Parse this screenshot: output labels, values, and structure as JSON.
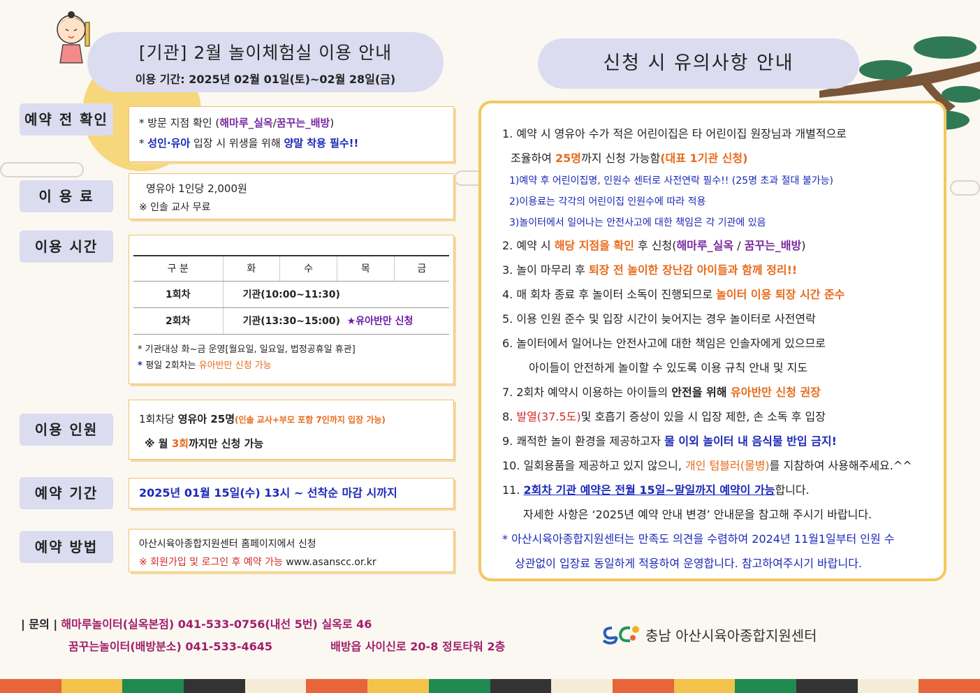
{
  "title": {
    "main": "[기관] 2월 놀이체험실 이용 안내",
    "period": "이용 기간: 2025년 02월 01일(토)~02월 28일(금)"
  },
  "notice_title": "신청 시 유의사항 안내",
  "sections": {
    "confirm": {
      "label": "예약 전 확인",
      "line1_a": "* 방문 지점 확인 (",
      "line1_b": "해마루_실옥",
      "line1_c": "/",
      "line1_d": "꿈꾸는_배방",
      "line1_e": ")",
      "line2_a": "* ",
      "line2_b": "성인·유아",
      "line2_c": " 입장 시 위생을 위해 ",
      "line2_d": "양말 착용 필수!!"
    },
    "fee": {
      "label": "이 용 료",
      "line1": "영유아 1인당 2,000원",
      "line2": "※ 인솔 교사 무료"
    },
    "time": {
      "label": "이용 시간",
      "headers": [
        "구 분",
        "화",
        "수",
        "목",
        "금"
      ],
      "rows": [
        {
          "session": "1회차",
          "value": "기관(10:00~11:30)",
          "extra": ""
        },
        {
          "session": "2회차",
          "value": "기관(13:30~15:00)",
          "extra": "★유아반만 신청"
        }
      ],
      "note1": "* 기관대상 화~금 운영[월요일, 일요일, 법정공휴일 휴관]",
      "note2_a": "* ",
      "note2_b": "평일 2회차는 ",
      "note2_c": "유아반만 신청 가능"
    },
    "people": {
      "label": "이용 인원",
      "line1_a": "1회차당 ",
      "line1_b": "영유아 25명",
      "line1_c": "(인솔 교사+부모 포함 7인까지 입장 가능)",
      "line2_a": "※ 월 ",
      "line2_b": "3회",
      "line2_c": "까지만 신청 가능"
    },
    "period": {
      "label": "예약 기간",
      "text": "2025년 01월 15일(수) 13시 ~ 선착순 마감 시까지"
    },
    "method": {
      "label": "예약 방법",
      "line1": "아산시육아종합지원센터 홈페이지에서 신청",
      "line2_a": "※ 회원가입 및 로그인 후 예약 가능",
      "line2_b": " www.asanscc.or.kr"
    }
  },
  "notices": {
    "n1a": "1. 예약 시 영유아 수가 적은 어린이집은 타 어린이집 원장님과 개별적으로",
    "n1b_a": "조율하여 ",
    "n1b_b": "25명",
    "n1b_c": "까지 신청 가능함",
    "n1b_d": "(대표 1기관 신청)",
    "s1": "1)예약 후 어린이집명, 인원수 센터로 사전연락 필수!! (25명 초과 절대 불가능)",
    "s2": "2)이용료는 각각의 어린이집 인원수에 따라 적용",
    "s3": "3)놀이터에서 일어나는 안전사고에 대한 책임은 각 기관에 있음",
    "n2_a": "2. 예약 시 ",
    "n2_b": "해당 지점을 확인",
    "n2_c": " 후 신청(",
    "n2_d": "해마루_실옥",
    "n2_e": " / ",
    "n2_f": "꿈꾸는_배방",
    "n2_g": ")",
    "n3_a": "3. 놀이 마무리 후 ",
    "n3_b": "퇴장 전 놀이한 장난감 아이들과 함께 정리!!",
    "n4_a": "4. 매 회차 종료 후 놀이터 소독이 진행되므로 ",
    "n4_b": "놀이터 이용 퇴장 시간 준수",
    "n5": "5. 이용 인원 준수 및 입장 시간이 늦어지는 경우 놀이터로 사전연락",
    "n6a": "6. 놀이터에서 일어나는 안전사고에 대한 책임은 인솔자에게 있으므로",
    "n6b": "아이들이 안전하게 놀이할 수 있도록 이용 규칙 안내 및 지도",
    "n7_a": "7. 2회차 예약시 이용하는 아이들의 ",
    "n7_b": "안전을 위해 ",
    "n7_c": "유아반만 신청 권장",
    "n8_a": "8. ",
    "n8_b": "발열(37.5도)",
    "n8_c": "및 호흡기 증상이 있을 시 입장 제한, 손 소독 후 입장",
    "n9_a": "9. 쾌적한 놀이 환경을 제공하고자 ",
    "n9_b": "물 이외 놀이터 내 음식물 반입 금지!",
    "n10_a": "10. 일회용품을 제공하고 있지 않으니, ",
    "n10_b": "개인 텀블러(물병)",
    "n10_c": "를 지참하여 사용해주세요.^^",
    "n11_a": "11. ",
    "n11_b": "2회차 기관 예약은 전월 15일~말일까지 예약이 가능",
    "n11_c": "합니다.",
    "n11b": "자세한 사항은 ‘2025년 예약 안내 변경’ 안내문을 참고해 주시기 바랍니다.",
    "star1": "* 아산시육아종합지원센터는 만족도 의견을 수렴하여 2024년 11월1일부터 인원 수",
    "star2": "상관없이 입장료 동일하게 적용하여 운영합니다. 참고하여주시기 바랍니다."
  },
  "footer": {
    "contact_label": "| 문의 |",
    "c1": "해마루놀이터(실옥본점) 041-533-0756(내선 5번) 실옥로 46",
    "c2": "꿈꾸는놀이터(배방분소) 041-533-4645",
    "c3": "배방읍 사이신로 20-8 정토타워 2층",
    "logo_text": "충남 아산시육아종합지원센터"
  },
  "colors": {
    "pill": "#dcdcf0",
    "border_gold": "#f2c860",
    "blue": "#1a28b8",
    "orange": "#e86a1a",
    "strip": [
      "#e8643a",
      "#f2c24a",
      "#1e8a50",
      "#333333",
      "#f5ecd8",
      "#e8643a",
      "#f2c24a",
      "#1e8a50",
      "#333333",
      "#f5ecd8",
      "#e8643a",
      "#f2c24a",
      "#1e8a50",
      "#333333",
      "#f5ecd8",
      "#e8643a"
    ]
  }
}
